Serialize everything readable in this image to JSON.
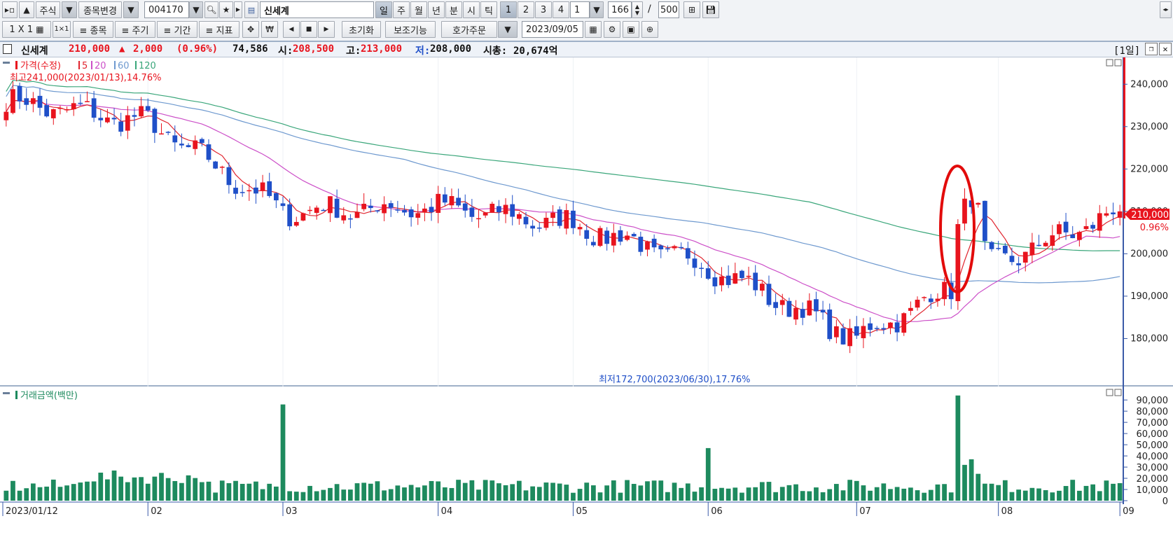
{
  "toolbar1": {
    "market_type": "주식",
    "change_stock": "종목변경",
    "stock_code": "004170",
    "stock_name": "신세계",
    "periods": [
      "일",
      "주",
      "월",
      "년",
      "분",
      "시",
      "틱"
    ],
    "active_period": "일",
    "multipliers": [
      "1",
      "2",
      "3",
      "4"
    ],
    "active_multiplier": "1",
    "interval_value": "1",
    "count_value": "166",
    "count_separator": "/",
    "count_max": "500"
  },
  "toolbar2": {
    "layout_label": "1 X 1",
    "menu_stock": "≡ 종목",
    "menu_period": "≡ 주기",
    "menu_range": "≡ 기간",
    "menu_indicator": "≡ 지표",
    "reset_label": "초기화",
    "aux_label": "보조기능",
    "order_label": "호가주문",
    "date_value": "2023/09/05"
  },
  "infobar": {
    "name": "신세계",
    "price": "210,000",
    "change_arrow": "▲",
    "change": "2,000",
    "change_pct": "(0.96%)",
    "volume": "74,586",
    "open_label": "시:",
    "open": "208,500",
    "high_label": "고:",
    "high": "213,000",
    "low_label": "저:",
    "low": "208,000",
    "mcap_label": "시총:",
    "mcap": "20,674억",
    "period_badge": "[1일]"
  },
  "price_pane": {
    "legend_title": "가격(수정)",
    "legend_ma": [
      "5",
      "20",
      "60",
      "120"
    ],
    "high_note": "최고241,000(2023/01/13),14.76%",
    "low_note": "최저172,700(2023/06/30),17.76%",
    "current_tag": "210,000",
    "current_pct": "0.96%"
  },
  "volume_pane": {
    "legend_title": "거래금액(백만)"
  },
  "colors": {
    "up": "#e8141e",
    "down": "#1f4fc8",
    "ma5": "#e0242e",
    "ma20": "#cc4fc8",
    "ma60": "#6e99cf",
    "ma120": "#3aa67a",
    "volume": "#1d8a5e",
    "annotation_circle": "#e20b0b"
  },
  "chart_data": [
    {
      "type": "candlestick",
      "title": "신세계",
      "y_ticks": [
        "240,000",
        "230,000",
        "220,000",
        "210,000",
        "200,000",
        "190,000",
        "180,000"
      ],
      "ylim": [
        170000,
        245000
      ],
      "x_ticks": [
        "2023/01/12",
        "02",
        "03",
        "04",
        "05",
        "06",
        "07",
        "08",
        "09"
      ],
      "series_names": [
        "가격(수정)",
        "5",
        "20",
        "60",
        "120"
      ],
      "annotations": [
        "최고241,000(2023/01/13),14.76%",
        "최저172,700(2023/06/30),17.76%"
      ],
      "monthly_close_approx": [
        {
          "x": "2023/01/12",
          "close": 236000
        },
        {
          "x": "02",
          "close": 231000
        },
        {
          "x": "03",
          "close": 210000
        },
        {
          "x": "04",
          "close": 211000
        },
        {
          "x": "05",
          "close": 207000
        },
        {
          "x": "06",
          "close": 197000
        },
        {
          "x": "07",
          "close": 180000
        },
        {
          "x": "08",
          "close": 198000
        },
        {
          "x": "09",
          "close": 210000
        }
      ],
      "last": {
        "open": 208500,
        "high": 213000,
        "low": 208000,
        "close": 210000
      }
    },
    {
      "type": "bar",
      "title": "거래금액(백만)",
      "y_ticks": [
        "90,000",
        "80,000",
        "70,000",
        "60,000",
        "50,000",
        "40,000",
        "30,000",
        "20,000",
        "10,000",
        "0"
      ],
      "ylim": [
        0,
        97000
      ],
      "x_ticks": [
        "2023/01/12",
        "02",
        "03",
        "04",
        "05",
        "06",
        "07",
        "08",
        "09"
      ],
      "peaks": [
        {
          "x": "03",
          "value": 86000
        },
        {
          "x": "06",
          "value": 47000
        },
        {
          "x": "08",
          "value": 94000
        }
      ]
    }
  ]
}
